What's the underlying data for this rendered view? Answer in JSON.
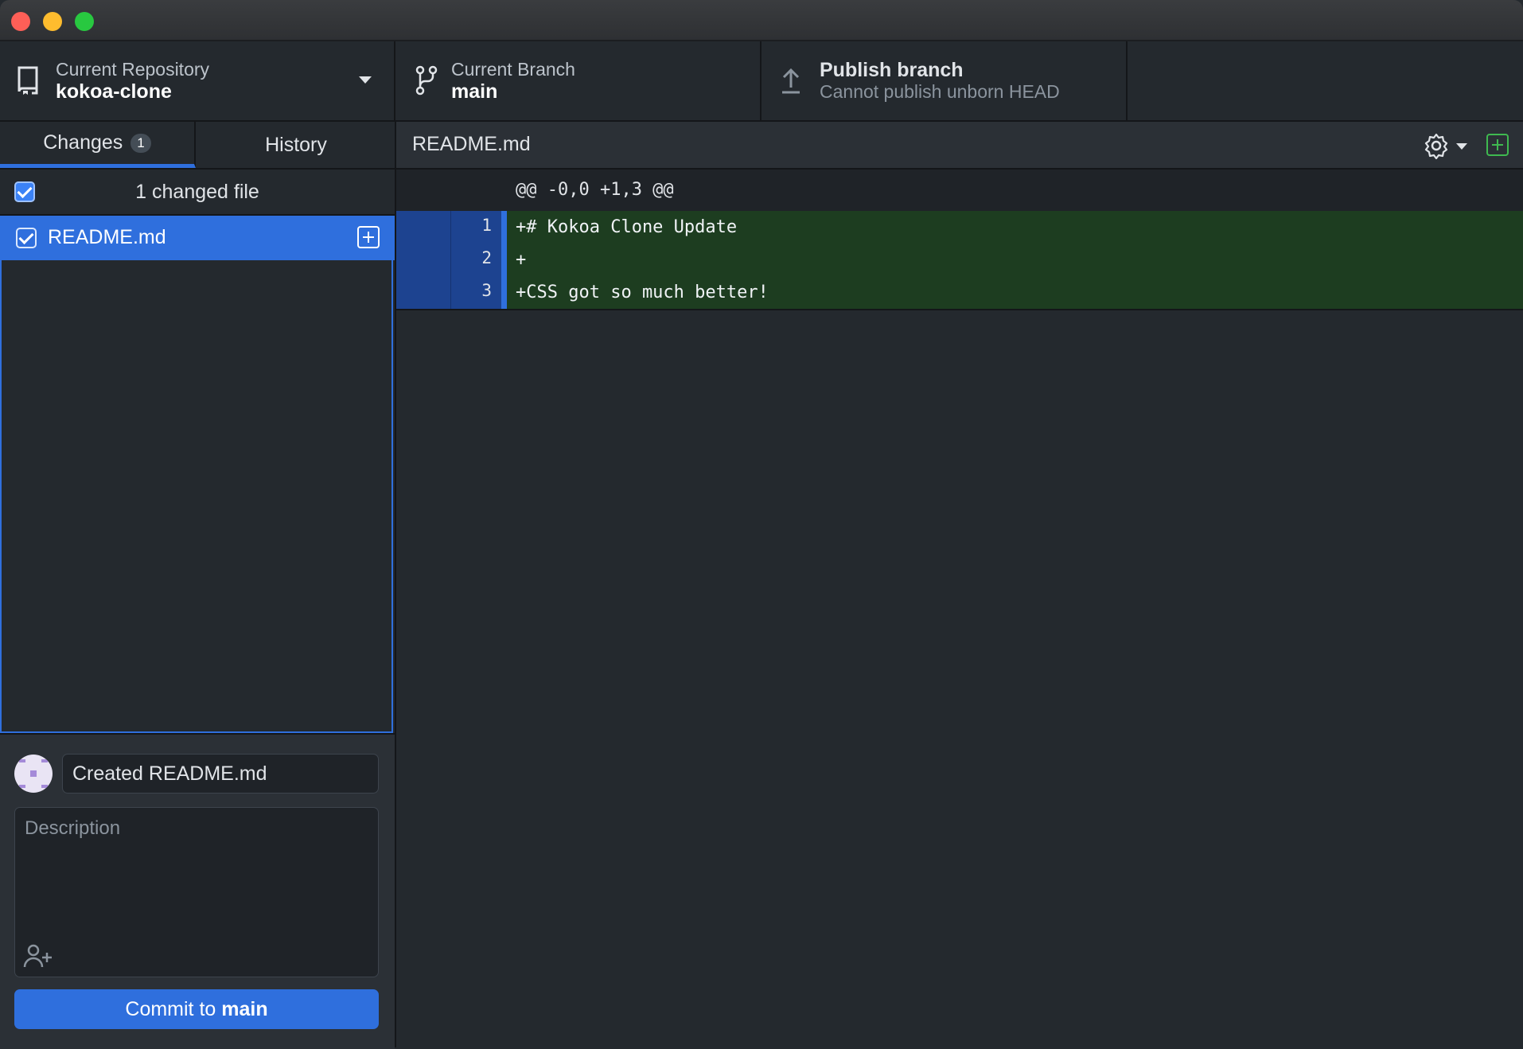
{
  "toolbar": {
    "repo": {
      "label": "Current Repository",
      "value": "kokoa-clone"
    },
    "branch": {
      "label": "Current Branch",
      "value": "main"
    },
    "publish": {
      "label": "Publish branch",
      "value": "Cannot publish unborn HEAD"
    }
  },
  "sidebar": {
    "tabs": [
      {
        "label": "Changes",
        "count": "1",
        "active": true
      },
      {
        "label": "History",
        "active": false
      }
    ],
    "summary": "1 changed file",
    "files": [
      {
        "name": "README.md",
        "status": "added",
        "checked": true
      }
    ]
  },
  "commit": {
    "summary_value": "Created README.md",
    "description_placeholder": "Description",
    "button_prefix": "Commit to",
    "button_branch": "main"
  },
  "diff": {
    "file": "README.md",
    "hunk_header": "@@ -0,0 +1,3 @@",
    "lines": [
      {
        "new_no": "1",
        "text": "+# Kokoa Clone Update"
      },
      {
        "new_no": "2",
        "text": "+"
      },
      {
        "new_no": "3",
        "text": "+CSS got so much better!"
      }
    ]
  },
  "colors": {
    "accent": "#2f6fdd",
    "added_line_bg": "#1d3d20",
    "added_icon": "#3fb950",
    "background": "#24292e"
  },
  "icons": [
    "repo-icon",
    "chevron-down-icon",
    "branch-icon",
    "upload-icon",
    "gear-icon",
    "add-file-icon",
    "add-coauthor-icon"
  ]
}
